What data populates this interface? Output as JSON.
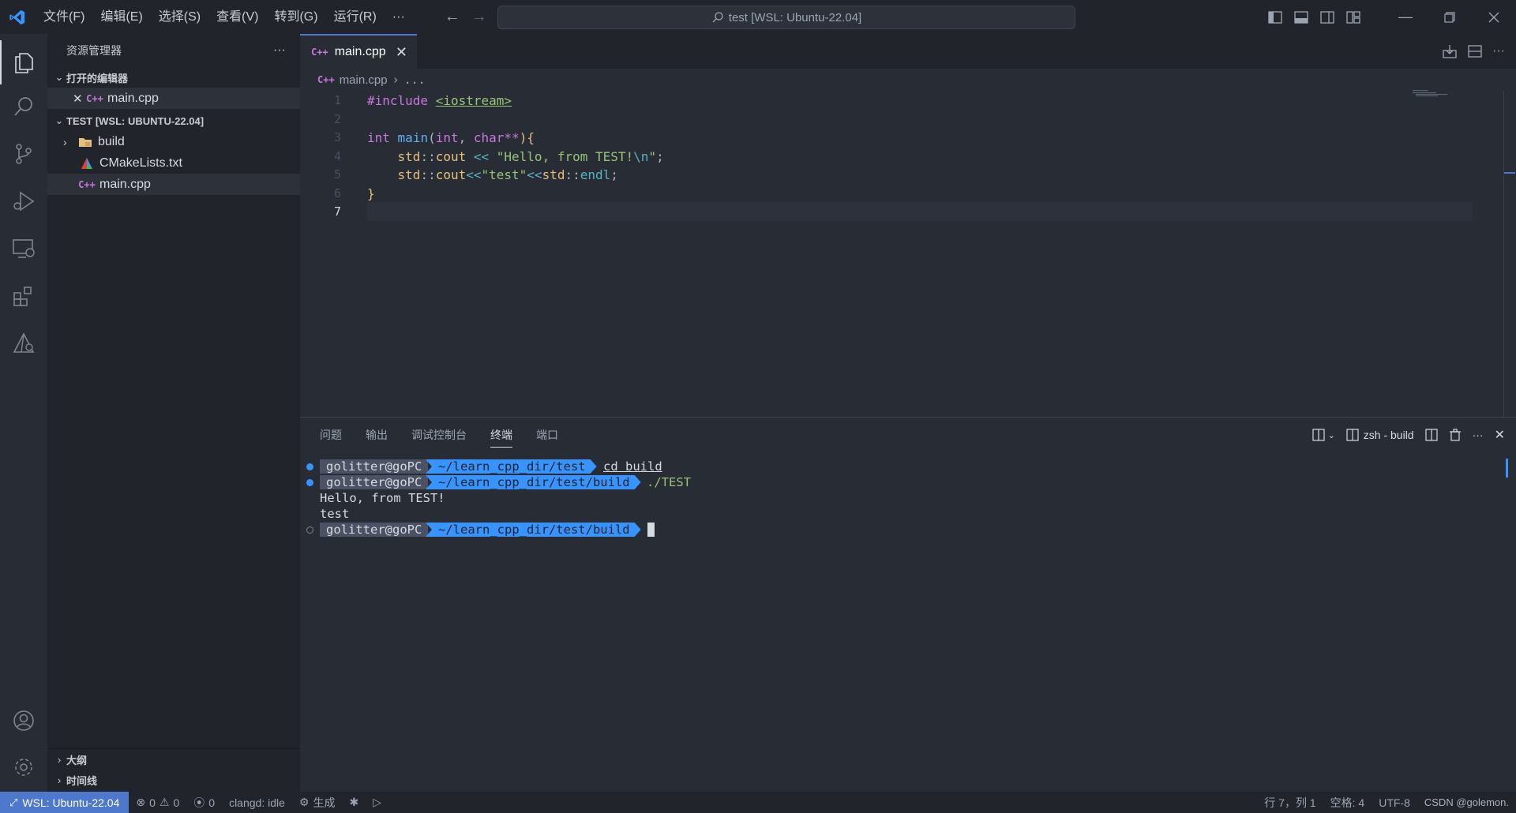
{
  "titlebar": {
    "menu": [
      "文件(F)",
      "编辑(E)",
      "选择(S)",
      "查看(V)",
      "转到(G)",
      "运行(R)",
      "···"
    ],
    "search_text": "test [WSL: Ubuntu-22.04]"
  },
  "sidebar": {
    "title": "资源管理器",
    "more": "···",
    "open_editors_label": "打开的编辑器",
    "open_editors": [
      {
        "name": "main.cpp"
      }
    ],
    "workspace_label": "TEST [WSL: UBUNTU-22.04]",
    "files": [
      {
        "name": "build",
        "type": "folder"
      },
      {
        "name": "CMakeLists.txt",
        "type": "cmake"
      },
      {
        "name": "main.cpp",
        "type": "cpp"
      }
    ],
    "outline_label": "大纲",
    "timeline_label": "时间线"
  },
  "editor": {
    "tab_label": "main.cpp",
    "breadcrumb_file": "main.cpp",
    "breadcrumb_more": "...",
    "line_numbers": [
      "1",
      "2",
      "3",
      "4",
      "5",
      "6",
      "7"
    ],
    "code": {
      "l1_directive": "#include",
      "l1_header": "<iostream>",
      "l3_a": "int",
      "l3_b": "main",
      "l3_c": "(",
      "l3_d": "int",
      "l3_e": ", ",
      "l3_f": "char",
      "l3_g": "**",
      "l3_h": "){",
      "l4_ns": "std",
      "l4_sep": "::",
      "l4_obj": "cout",
      "l4_op": " << ",
      "l4_str": "\"Hello, from TEST!",
      "l4_esc": "\\n",
      "l4_strend": "\"",
      "l4_end": ";",
      "l5_ns": "std",
      "l5_sep": "::",
      "l5_obj": "cout",
      "l5_op": "<<",
      "l5_str": "\"test\"",
      "l5_op2": "<<",
      "l5_ns2": "std",
      "l5_sep2": "::",
      "l5_fn": "endl",
      "l5_end": ";",
      "l6": "}"
    }
  },
  "panel": {
    "tabs": [
      "问题",
      "输出",
      "调试控制台",
      "终端",
      "端口"
    ],
    "active_tab": "终端",
    "terminal_name": "zsh - build",
    "lines": [
      {
        "user": "golitter@goPC",
        "path": "~/learn_cpp_dir/test",
        "cmd": "cd build"
      },
      {
        "user": "golitter@goPC",
        "path": "~/learn_cpp_dir/test/build",
        "cmd": "./TEST"
      }
    ],
    "output": [
      "Hello, from TEST!",
      "test"
    ],
    "prompt": {
      "user": "golitter@goPC",
      "path": "~/learn_cpp_dir/test/build"
    }
  },
  "statusbar": {
    "remote": "WSL: Ubuntu-22.04",
    "errors": "0",
    "warnings": "0",
    "ports": "0",
    "clangd": "clangd: idle",
    "build": "生成",
    "position": "行 7，列 1",
    "spaces": "空格: 4",
    "encoding": "UTF-8",
    "watermark": "CSDN @golemon."
  },
  "colors": {
    "accent": "#4d78cc",
    "terminal_path_bg": "#3794ff",
    "cpp_icon": "#c678dd"
  }
}
